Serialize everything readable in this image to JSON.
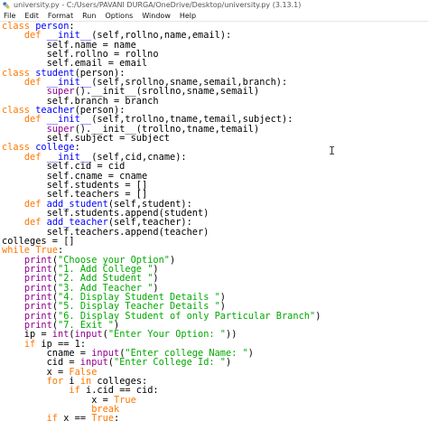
{
  "window": {
    "title": "university.py - C:/Users/PAVANI DURGA/OneDrive/Desktop/university.py (3.13.1)",
    "icon": "python-idle-icon"
  },
  "menu": [
    "File",
    "Edit",
    "Format",
    "Run",
    "Options",
    "Window",
    "Help"
  ],
  "colors": {
    "keyword": "#ff7700",
    "definition": "#0000ff",
    "builtin": "#900090",
    "string": "#00aa00"
  },
  "code_lines": [
    [
      [
        "kw",
        "class"
      ],
      [
        "t",
        " "
      ],
      [
        "def",
        "person"
      ],
      [
        "t",
        ":"
      ]
    ],
    [
      [
        "t",
        "    "
      ],
      [
        "kw",
        "def"
      ],
      [
        "t",
        " "
      ],
      [
        "def",
        "__init__"
      ],
      [
        "t",
        "(self,rollno,name,email):"
      ]
    ],
    [
      [
        "t",
        "        self.name = name"
      ]
    ],
    [
      [
        "t",
        "        self.rollno = rollno"
      ]
    ],
    [
      [
        "t",
        "        self.email = email"
      ]
    ],
    [
      [
        "kw",
        "class"
      ],
      [
        "t",
        " "
      ],
      [
        "def",
        "student"
      ],
      [
        "t",
        "(person):"
      ]
    ],
    [
      [
        "t",
        "    "
      ],
      [
        "kw",
        "def"
      ],
      [
        "t",
        " "
      ],
      [
        "def",
        "__init__"
      ],
      [
        "t",
        "(self,srollno,sname,semail,branch):"
      ]
    ],
    [
      [
        "t",
        "        "
      ],
      [
        "bi",
        "super"
      ],
      [
        "t",
        "().__init__(srollno,sname,semail)"
      ]
    ],
    [
      [
        "t",
        "        self.branch = branch"
      ]
    ],
    [
      [
        "kw",
        "class"
      ],
      [
        "t",
        " "
      ],
      [
        "def",
        "teacher"
      ],
      [
        "t",
        "(person):"
      ]
    ],
    [
      [
        "t",
        "    "
      ],
      [
        "kw",
        "def"
      ],
      [
        "t",
        " "
      ],
      [
        "def",
        "__init__"
      ],
      [
        "t",
        "(self,trollno,tname,temail,subject):"
      ]
    ],
    [
      [
        "t",
        "        "
      ],
      [
        "bi",
        "super"
      ],
      [
        "t",
        "().__init__(trollno,tname,temail)"
      ]
    ],
    [
      [
        "t",
        "        self.subject = subject"
      ]
    ],
    [
      [
        "kw",
        "class"
      ],
      [
        "t",
        " "
      ],
      [
        "def",
        "college"
      ],
      [
        "t",
        ":"
      ]
    ],
    [
      [
        "t",
        "    "
      ],
      [
        "kw",
        "def"
      ],
      [
        "t",
        " "
      ],
      [
        "def",
        "__init__"
      ],
      [
        "t",
        "(self,cid,cname):"
      ]
    ],
    [
      [
        "t",
        "        self.cid = cid"
      ]
    ],
    [
      [
        "t",
        "        self.cname = cname"
      ]
    ],
    [
      [
        "t",
        "        self.students = []"
      ]
    ],
    [
      [
        "t",
        "        self.teachers = []"
      ]
    ],
    [
      [
        "t",
        "    "
      ],
      [
        "kw",
        "def"
      ],
      [
        "t",
        " "
      ],
      [
        "def",
        "add_student"
      ],
      [
        "t",
        "(self,student):"
      ]
    ],
    [
      [
        "t",
        "        self.students.append(student)"
      ]
    ],
    [
      [
        "t",
        "    "
      ],
      [
        "kw",
        "def"
      ],
      [
        "t",
        " "
      ],
      [
        "def",
        "add_teacher"
      ],
      [
        "t",
        "(self,teacher):"
      ]
    ],
    [
      [
        "t",
        "        self.teachers.append(teacher)"
      ]
    ],
    [
      [
        "t",
        "colleges = []"
      ]
    ],
    [
      [
        "kw",
        "while"
      ],
      [
        "t",
        " "
      ],
      [
        "kw",
        "True"
      ],
      [
        "t",
        ":"
      ]
    ],
    [
      [
        "t",
        "    "
      ],
      [
        "bi",
        "print"
      ],
      [
        "t",
        "("
      ],
      [
        "str",
        "\"Choose your Option\""
      ],
      [
        "t",
        ")"
      ]
    ],
    [
      [
        "t",
        "    "
      ],
      [
        "bi",
        "print"
      ],
      [
        "t",
        "("
      ],
      [
        "str",
        "\"1. Add College \""
      ],
      [
        "t",
        ")"
      ]
    ],
    [
      [
        "t",
        "    "
      ],
      [
        "bi",
        "print"
      ],
      [
        "t",
        "("
      ],
      [
        "str",
        "\"2. Add Student \""
      ],
      [
        "t",
        ")"
      ]
    ],
    [
      [
        "t",
        "    "
      ],
      [
        "bi",
        "print"
      ],
      [
        "t",
        "("
      ],
      [
        "str",
        "\"3. Add Teacher \""
      ],
      [
        "t",
        ")"
      ]
    ],
    [
      [
        "t",
        "    "
      ],
      [
        "bi",
        "print"
      ],
      [
        "t",
        "("
      ],
      [
        "str",
        "\"4. Display Student Details \""
      ],
      [
        "t",
        ")"
      ]
    ],
    [
      [
        "t",
        "    "
      ],
      [
        "bi",
        "print"
      ],
      [
        "t",
        "("
      ],
      [
        "str",
        "\"5. Display Teacher Details \""
      ],
      [
        "t",
        ")"
      ]
    ],
    [
      [
        "t",
        "    "
      ],
      [
        "bi",
        "print"
      ],
      [
        "t",
        "("
      ],
      [
        "str",
        "\"6. Display Student of only Particular Branch\""
      ],
      [
        "t",
        ")"
      ]
    ],
    [
      [
        "t",
        "    "
      ],
      [
        "bi",
        "print"
      ],
      [
        "t",
        "("
      ],
      [
        "str",
        "\"7. Exit \""
      ],
      [
        "t",
        ")"
      ]
    ],
    [
      [
        "t",
        "    ip = "
      ],
      [
        "bi",
        "int"
      ],
      [
        "t",
        "("
      ],
      [
        "bi",
        "input"
      ],
      [
        "t",
        "("
      ],
      [
        "str",
        "\"Enter Your Option: \""
      ],
      [
        "t",
        "))"
      ]
    ],
    [
      [
        "t",
        "    "
      ],
      [
        "kw",
        "if"
      ],
      [
        "t",
        " ip == 1:"
      ]
    ],
    [
      [
        "t",
        "        cname = "
      ],
      [
        "bi",
        "input"
      ],
      [
        "t",
        "("
      ],
      [
        "str",
        "\"Enter college Name: \""
      ],
      [
        "t",
        ")"
      ]
    ],
    [
      [
        "t",
        "        cid = "
      ],
      [
        "bi",
        "input"
      ],
      [
        "t",
        "("
      ],
      [
        "str",
        "\"Enter College Id: \""
      ],
      [
        "t",
        ")"
      ]
    ],
    [
      [
        "t",
        "        x = "
      ],
      [
        "kw",
        "False"
      ]
    ],
    [
      [
        "t",
        "        "
      ],
      [
        "kw",
        "for"
      ],
      [
        "t",
        " i "
      ],
      [
        "kw",
        "in"
      ],
      [
        "t",
        " colleges:"
      ]
    ],
    [
      [
        "t",
        "            "
      ],
      [
        "kw",
        "if"
      ],
      [
        "t",
        " i.cid == cid:"
      ]
    ],
    [
      [
        "t",
        "                x = "
      ],
      [
        "kw",
        "True"
      ]
    ],
    [
      [
        "t",
        "                "
      ],
      [
        "kw",
        "break"
      ]
    ],
    [
      [
        "t",
        "        "
      ],
      [
        "kw",
        "if"
      ],
      [
        "t",
        " x == "
      ],
      [
        "kw",
        "True"
      ],
      [
        "t",
        ":"
      ]
    ]
  ]
}
